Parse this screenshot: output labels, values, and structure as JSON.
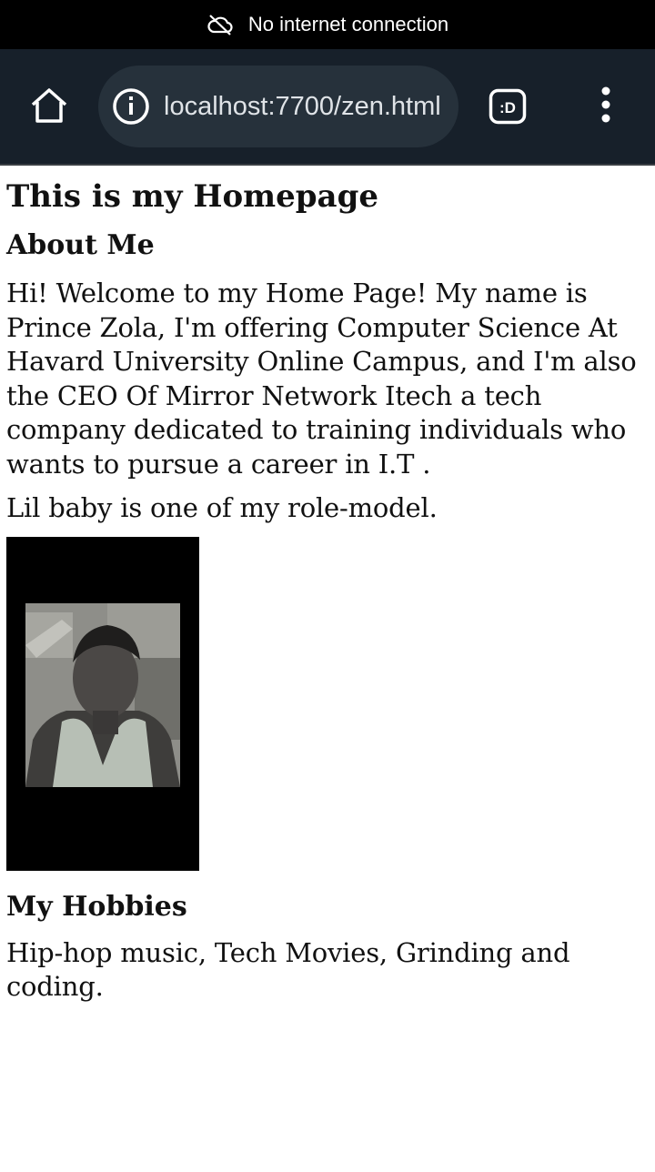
{
  "status_bar": {
    "text": "No internet connection",
    "icon": "cloud-off-icon"
  },
  "browser": {
    "url": "localhost:7700/zen.html",
    "home_icon": "home-icon",
    "info_icon": "info-icon",
    "extension_label": ":D",
    "menu_icon": "more-vert-icon",
    "toolbar_color": "#17202a",
    "pill_color": "#26313b"
  },
  "page": {
    "title": "This is my Homepage",
    "about_heading": "About Me",
    "about_text": "Hi! Welcome to my Home Page! My name is Prince Zola, I'm offering Computer Science At Havard University Online Campus, and I'm also the CEO Of Mirror Network Itech a tech company dedicated to training individuals who wants to pursue a career in I.T .",
    "role_model_text": "Lil baby is one of my role-model.",
    "hobbies_heading": "My Hobbies",
    "hobbies_text": "Hip-hop music, Tech Movies, Grinding and coding."
  }
}
